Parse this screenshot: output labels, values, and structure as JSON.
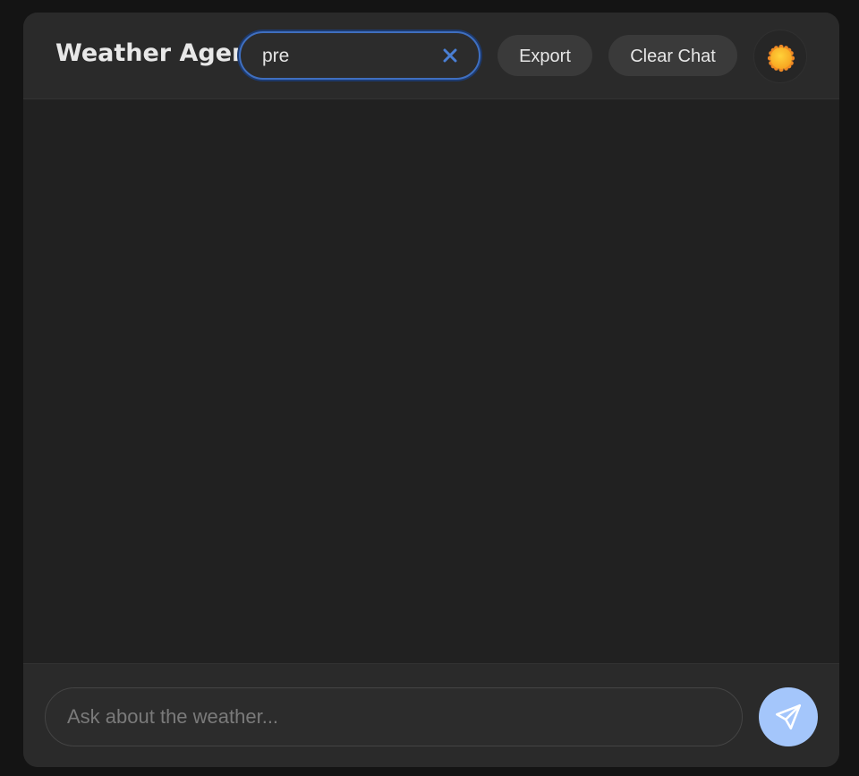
{
  "header": {
    "title": "Weather Agent",
    "search": {
      "value": "pre",
      "clear_icon": "close-icon"
    },
    "export_label": "Export",
    "clear_chat_label": "Clear Chat",
    "theme_icon": "sun-icon"
  },
  "composer": {
    "placeholder": "Ask about the weather...",
    "send_icon": "send-icon"
  },
  "colors": {
    "accent": "#3f6fc0",
    "send_button": "#a4c6fb",
    "background": "#212121"
  }
}
